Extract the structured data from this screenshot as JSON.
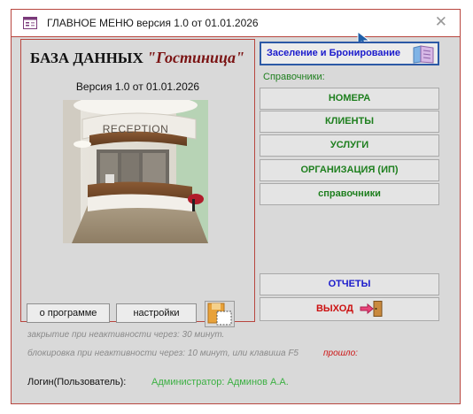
{
  "window": {
    "title": "ГЛАВНОЕ МЕНЮ версия 1.0 от 01.01.2026",
    "close_symbol": "✕"
  },
  "left_panel": {
    "db_title_prefix": "БАЗА ДАННЫХ ",
    "db_title_name": "\"Гостиница\"",
    "version": "Версия 1.0 от 01.01.2026",
    "photo_sign": "RECEPTION",
    "about_button": "о программе",
    "settings_button": "настройки"
  },
  "right_panel": {
    "main_button": "Заселение и Бронирование",
    "references_label": "Справочники:",
    "buttons": [
      {
        "label": "НОМЕРА"
      },
      {
        "label": "КЛИЕНТЫ"
      },
      {
        "label": "УСЛУГИ"
      },
      {
        "label": "ОРГАНИЗАЦИЯ (ИП)"
      },
      {
        "label": "справочники"
      }
    ],
    "reports_button": "ОТЧЕТЫ",
    "exit_button": "ВЫХОД"
  },
  "status": {
    "inactivity_close": "закрытие при неактивности через: 30 минут.",
    "inactivity_lock": "блокировка при неактивности через: 10 минут, или клавиша F5",
    "elapsed_label": "прошло:"
  },
  "login": {
    "label": "Логин(Пользователь):",
    "value": "Администратор: Админов А.А."
  },
  "icons": {
    "title": "form-icon",
    "books": "books-icon",
    "exit": "door-exit-icon",
    "settings_file": "floppy-icon",
    "cursor": "mouse-cursor-icon"
  },
  "colors": {
    "accent_border": "#b8463f",
    "green_text": "#1e7f1e",
    "blue_text": "#1a1acc",
    "red_text": "#cc1111",
    "login_green": "#3cb043"
  }
}
